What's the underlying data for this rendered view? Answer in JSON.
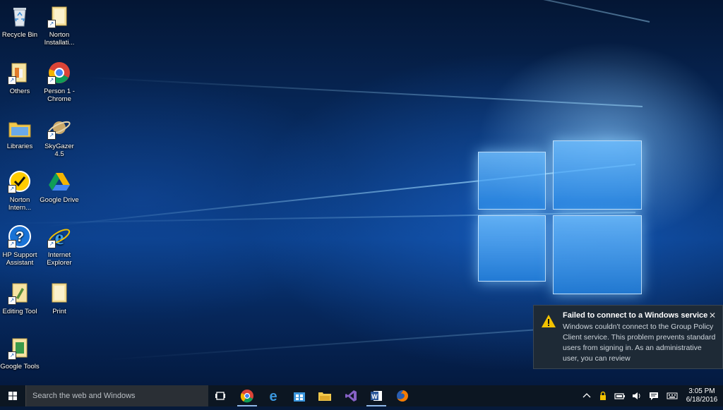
{
  "desktop_icons": [
    {
      "label": "Recycle Bin",
      "icon": "recycle-bin-icon"
    },
    {
      "label": "Norton Installati...",
      "icon": "folder-icon"
    },
    {
      "label": "Others",
      "icon": "folder-icon"
    },
    {
      "label": "Person 1 - Chrome",
      "icon": "chrome-icon"
    },
    {
      "label": "Libraries",
      "icon": "libraries-icon"
    },
    {
      "label": "SkyGazer 4.5",
      "icon": "skygazer-icon"
    },
    {
      "label": "Norton Intern...",
      "icon": "norton-icon"
    },
    {
      "label": "Google Drive",
      "icon": "google-drive-icon"
    },
    {
      "label": "HP Support Assistant",
      "icon": "help-icon"
    },
    {
      "label": "Internet Explorer",
      "icon": "internet-explorer-icon"
    },
    {
      "label": "Editing Tool",
      "icon": "folder-icon"
    },
    {
      "label": "Print",
      "icon": "folder-icon"
    },
    {
      "label": "Google Tools",
      "icon": "folder-icon"
    }
  ],
  "notification": {
    "title": "Failed to connect to a Windows service",
    "body": "Windows couldn't connect to the Group Policy Client service. This problem prevents standard users from signing in. As an administrative user, you can review",
    "close": "✕"
  },
  "taskbar": {
    "search_placeholder": "Search the web and Windows",
    "apps": [
      "task-view-icon",
      "chrome-icon",
      "edge-icon",
      "store-icon",
      "file-explorer-icon",
      "visual-studio-icon",
      "word-icon",
      "firefox-icon"
    ],
    "clock_time": "3:05 PM",
    "clock_date": "6/18/2016"
  },
  "colors": {
    "accent": "#1e88e5",
    "taskbar": "#0c1622",
    "toast": "#1e2a36",
    "warning": "#f2c200"
  }
}
